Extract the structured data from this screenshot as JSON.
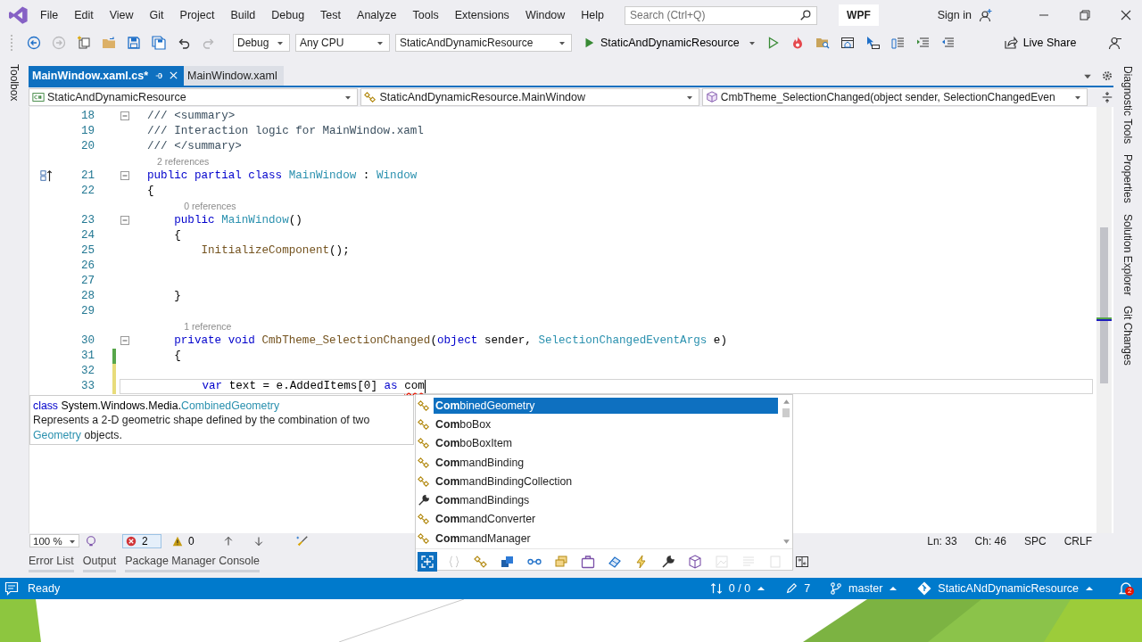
{
  "menu": [
    "File",
    "Edit",
    "View",
    "Git",
    "Project",
    "Build",
    "Debug",
    "Test",
    "Analyze",
    "Tools",
    "Extensions",
    "Window",
    "Help"
  ],
  "search": {
    "placeholder": "Search (Ctrl+Q)"
  },
  "solution_badge": "WPF",
  "sign_in": "Sign in",
  "toolbar": {
    "left_buttons": [
      {
        "kind": "back",
        "disabled": false
      },
      {
        "kind": "forward",
        "disabled": true
      },
      {
        "kind": "new-item",
        "disabled": false
      },
      {
        "kind": "folder",
        "disabled": false
      },
      {
        "kind": "save",
        "disabled": false
      },
      {
        "kind": "save-all",
        "disabled": false
      },
      {
        "kind": "undo",
        "disabled": false
      },
      {
        "kind": "redo",
        "disabled": true
      }
    ],
    "configuration": "Debug",
    "platform": "Any CPU",
    "startup_project": "StaticAndDynamicResource",
    "run_target": "StaticAndDynamicResource",
    "right_buttons": [
      {
        "kind": "play-outline",
        "disabled": false
      },
      {
        "kind": "flame",
        "disabled": false
      },
      {
        "kind": "folder-search",
        "disabled": false
      },
      {
        "kind": "window",
        "disabled": false
      },
      {
        "kind": "cursor",
        "disabled": false
      },
      {
        "kind": "columns",
        "disabled": false
      },
      {
        "kind": "indent",
        "disabled": false
      },
      {
        "kind": "outdent",
        "disabled": false
      }
    ],
    "live_share": "Live Share"
  },
  "left_panels": [
    "Toolbox"
  ],
  "right_panels": [
    "Diagnostic Tools",
    "Properties",
    "Solution Explorer",
    "Git Changes"
  ],
  "tabs": [
    {
      "label": "MainWindow.xaml.cs*",
      "selected": true
    },
    {
      "label": "MainWindow.xaml",
      "selected": false
    }
  ],
  "navigation": [
    {
      "kind": "project",
      "text": "StaticAndDynamicResource"
    },
    {
      "kind": "class",
      "text": "StaticAndDynamicResource.MainWindow"
    },
    {
      "kind": "method",
      "text": "CmbTheme_SelectionChanged(object sender, SelectionChangedEven"
    }
  ],
  "editor": {
    "lines": [
      {
        "kind": "code",
        "number": "18",
        "fold": true,
        "current": false,
        "tokens": [
          {
            "text": "/// <summary>",
            "kind": "doc"
          }
        ]
      },
      {
        "kind": "code",
        "number": "19",
        "fold": false,
        "current": false,
        "tokens": [
          {
            "text": "/// Interaction logic for MainWindow.xaml",
            "kind": "doc"
          }
        ]
      },
      {
        "kind": "code",
        "number": "20",
        "fold": false,
        "current": false,
        "tokens": [
          {
            "text": "/// </summary>",
            "kind": "doc"
          }
        ]
      },
      {
        "kind": "lens",
        "text": "2 references"
      },
      {
        "kind": "code",
        "number": "21",
        "fold": true,
        "current": false,
        "glyph": true,
        "tokens": [
          {
            "text": "public partial class ",
            "kind": "keyword"
          },
          {
            "text": "MainWindow",
            "kind": "type"
          },
          {
            "text": " : ",
            "kind": "plain"
          },
          {
            "text": "Window",
            "kind": "type"
          }
        ]
      },
      {
        "kind": "code",
        "number": "22",
        "fold": false,
        "current": false,
        "tokens": [
          {
            "text": "{",
            "kind": "plain"
          }
        ]
      },
      {
        "kind": "lens",
        "text": "    0 references"
      },
      {
        "kind": "code",
        "number": "23",
        "fold": true,
        "current": false,
        "tokens": [
          {
            "text": "    public ",
            "kind": "keyword"
          },
          {
            "text": "MainWindow",
            "kind": "type"
          },
          {
            "text": "()",
            "kind": "plain"
          }
        ]
      },
      {
        "kind": "code",
        "number": "24",
        "fold": false,
        "current": false,
        "tokens": [
          {
            "text": "    {",
            "kind": "plain"
          }
        ]
      },
      {
        "kind": "code",
        "number": "25",
        "fold": false,
        "current": false,
        "tokens": [
          {
            "text": "        InitializeComponent",
            "kind": "method"
          },
          {
            "text": "();",
            "kind": "plain"
          }
        ]
      },
      {
        "kind": "code",
        "number": "26",
        "fold": false,
        "current": false
      },
      {
        "kind": "code",
        "number": "27",
        "fold": false,
        "current": false
      },
      {
        "kind": "code",
        "number": "28",
        "fold": false,
        "current": false,
        "tokens": [
          {
            "text": "    }",
            "kind": "plain"
          }
        ]
      },
      {
        "kind": "code",
        "number": "29",
        "fold": false,
        "current": false
      },
      {
        "kind": "lens",
        "text": "    1 reference"
      },
      {
        "kind": "code",
        "number": "30",
        "fold": true,
        "current": false,
        "tokens": [
          {
            "text": "    private void ",
            "kind": "keyword"
          },
          {
            "text": "CmbTheme_SelectionChanged",
            "kind": "method"
          },
          {
            "text": "(",
            "kind": "plain"
          },
          {
            "text": "object",
            "kind": "keyword"
          },
          {
            "text": " sender, ",
            "kind": "plain"
          },
          {
            "text": "SelectionChangedEventArgs",
            "kind": "type"
          },
          {
            "text": " e)",
            "kind": "plain"
          }
        ]
      },
      {
        "kind": "code",
        "number": "31",
        "fold": false,
        "current": false,
        "color": "#57a64a",
        "tokens": [
          {
            "text": "    {",
            "kind": "plain"
          }
        ]
      },
      {
        "kind": "code",
        "number": "32",
        "fold": false,
        "current": false,
        "color": "#e8dc7a"
      },
      {
        "kind": "code",
        "number": "33",
        "fold": false,
        "current": true,
        "color": "#e8dc7a",
        "caret": true,
        "tokens": [
          {
            "text": "        var",
            "kind": "keyword"
          },
          {
            "text": " text = e.AddedItems[0] ",
            "kind": "plain"
          },
          {
            "text": "as ",
            "kind": "keyword"
          },
          {
            "text": "com",
            "kind": "error"
          }
        ]
      }
    ],
    "tooltip": {
      "signature": [
        {
          "text": "class",
          "kind": "keyword"
        },
        {
          "text": " System.Windows.Media.",
          "kind": "plain"
        },
        {
          "text": "CombinedGeometry",
          "kind": "type"
        }
      ],
      "before": "Represents a 2-D geometric shape defined by the combination of two ",
      "link": "Geometry",
      "after": " objects."
    },
    "completion": {
      "items": [
        {
          "kind": "class",
          "label": "**Com**binedGeometry",
          "selected": true
        },
        {
          "kind": "class",
          "label": "**Com**boBox",
          "selected": false
        },
        {
          "kind": "class",
          "label": "**Com**boBoxItem",
          "selected": false
        },
        {
          "kind": "class",
          "label": "**Com**mandBinding",
          "selected": false
        },
        {
          "kind": "class",
          "label": "**Com**mandBindingCollection",
          "selected": false
        },
        {
          "kind": "property",
          "label": "**Com**mandBindings",
          "selected": false
        },
        {
          "kind": "class",
          "label": "**Com**mandConverter",
          "selected": false
        },
        {
          "kind": "class",
          "label": "**Com**mandManager",
          "selected": false
        }
      ],
      "filters": [
        {
          "kind": "expand",
          "on": true,
          "disabled": false
        },
        {
          "kind": "braces",
          "on": false,
          "disabled": true
        },
        {
          "kind": "diagram",
          "on": false,
          "disabled": false
        },
        {
          "kind": "squares",
          "on": false,
          "disabled": false
        },
        {
          "kind": "link",
          "on": false,
          "disabled": false
        },
        {
          "kind": "stack",
          "on": false,
          "disabled": false
        },
        {
          "kind": "briefcase",
          "on": false,
          "disabled": false
        },
        {
          "kind": "eraser",
          "on": false,
          "disabled": false
        },
        {
          "kind": "bolt",
          "on": false,
          "disabled": false
        },
        {
          "kind": "wrench",
          "on": false,
          "disabled": false
        },
        {
          "kind": "cube",
          "on": false,
          "disabled": false
        },
        {
          "kind": "image",
          "on": false,
          "disabled": true
        },
        {
          "kind": "lines",
          "on": false,
          "disabled": true
        },
        {
          "kind": "page",
          "on": false,
          "disabled": true
        },
        {
          "kind": "swap",
          "on": false,
          "disabled": false
        }
      ]
    },
    "zoom": "100 %",
    "errors": "2",
    "warnings": "0",
    "position": {
      "line": "Ln: 33",
      "column": "Ch: 46",
      "indent": "SPC",
      "line_ending": "CRLF"
    }
  },
  "tool_tabs": [
    {
      "label": "Error List",
      "selected": false
    },
    {
      "label": "Output",
      "selected": false
    },
    {
      "label": "Package Manager Console",
      "selected": false
    }
  ],
  "status_bar": {
    "message": "Ready",
    "sync": "0 / 0",
    "changes": "7",
    "branch": "master",
    "repository": "StaticANdDynamicResource",
    "notifications": "2"
  }
}
